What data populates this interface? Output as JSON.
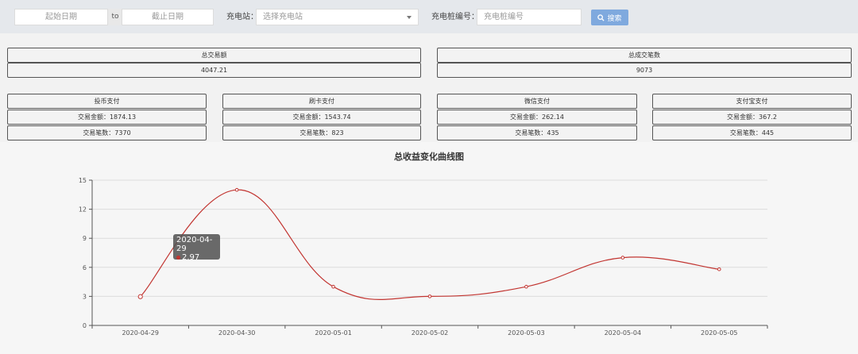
{
  "filters": {
    "start_date_placeholder": "起始日期",
    "to_label": "to",
    "end_date_placeholder": "截止日期",
    "station_label": "充电站：",
    "station_placeholder": "选择充电站",
    "pile_label": "充电桩编号：",
    "pile_placeholder": "充电桩编号",
    "search_label": "搜索"
  },
  "summary": {
    "total_amount_title": "总交易额",
    "total_amount_value": "4047.21",
    "total_count_title": "总成交笔数",
    "total_count_value": "9073"
  },
  "payments": [
    {
      "title": "投币支付",
      "amount": "交易金额：1874.13",
      "count": "交易笔数：7370"
    },
    {
      "title": "刷卡支付",
      "amount": "交易金额：1543.74",
      "count": "交易笔数：823"
    },
    {
      "title": "微信支付",
      "amount": "交易金额：262.14",
      "count": "交易笔数：435"
    },
    {
      "title": "支付宝支付",
      "amount": "交易金额：367.2",
      "count": "交易笔数：445"
    }
  ],
  "tooltip": {
    "date": "2020-04-29",
    "value": "2.97"
  },
  "chart_data": {
    "type": "line",
    "title": "总收益变化曲线图",
    "categories": [
      "2020-04-29",
      "2020-04-30",
      "2020-05-01",
      "2020-05-02",
      "2020-05-03",
      "2020-05-04",
      "2020-05-05"
    ],
    "series": [
      {
        "values": [
          2.97,
          14,
          4,
          3,
          4,
          7,
          5.8
        ]
      }
    ],
    "ylim": [
      0,
      15
    ],
    "yticks": [
      0,
      3,
      6,
      9,
      12,
      15
    ],
    "line_color": "#c23531",
    "grid": true
  }
}
